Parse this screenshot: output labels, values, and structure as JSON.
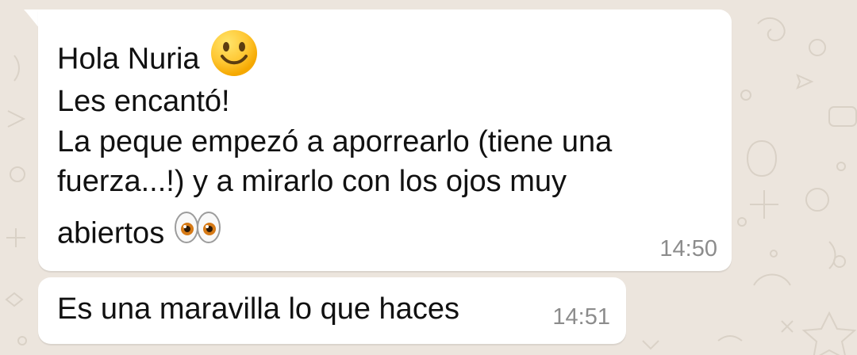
{
  "theme": {
    "wallpaper": "#ece5dd",
    "bubble": "#ffffff",
    "text": "#111111",
    "time": "#8c8c8c"
  },
  "messages": [
    {
      "line1": "Hola Nuria",
      "line2": "Les encantó!",
      "line3": "La peque empezó a aporrearlo (tiene una",
      "line4": "fuerza...!) y a mirarlo con los ojos muy",
      "line5": "abiertos",
      "time": "14:50",
      "emoji_after_line1": "slightly-smiling-face-icon",
      "emoji_after_line5": "eyes-icon"
    },
    {
      "line1": "Es una maravilla lo que haces",
      "time": "14:51"
    }
  ]
}
